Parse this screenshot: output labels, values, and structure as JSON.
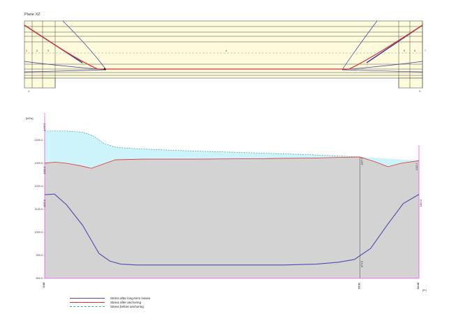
{
  "top_diagram": {
    "title": "Plane XZ",
    "span_labels_left": [
      "1",
      "2",
      "3"
    ],
    "span_label_center": "4",
    "span_labels_right": [
      "5",
      "6",
      "7"
    ],
    "support_left": "A",
    "support_right": "B",
    "colors": {
      "fill": "#fdfbdc",
      "tendon": "#dd3333",
      "guide": "#3b3b9a"
    }
  },
  "chart_data": {
    "type": "line",
    "ylabel": "[MPa]",
    "xlabel": "[m]",
    "ylim": [
      800,
      1500
    ],
    "xlim": [
      0,
      34.45
    ],
    "y_ticks": [
      "1400.0",
      "1300.0",
      "1200.0",
      "1100.0",
      "1000.0",
      "900.0",
      "800.0"
    ],
    "x_tick_labels": [
      "0.00",
      "29.01",
      "34.45"
    ],
    "annotations": [
      "1440.0",
      "1300.6",
      "1327.5",
      "1311.2",
      "1163.6",
      "1164.8",
      "874.8"
    ],
    "series": [
      {
        "name": "Stress after long-term losses",
        "color": "#4b4bb0",
        "x": [
          0,
          0.9,
          2.0,
          3.5,
          5.0,
          6.0,
          7.0,
          8.5,
          10,
          14,
          18,
          22,
          25,
          27,
          28.5,
          30,
          31.5,
          33,
          34.45
        ],
        "y": [
          1163.6,
          1166,
          1120,
          1030,
          908,
          875,
          862,
          858,
          858,
          858,
          858,
          858,
          862,
          870,
          882,
          930,
          1030,
          1125,
          1164.8
        ]
      },
      {
        "name": "Stress after anchoring",
        "color": "#dd3333",
        "x": [
          0,
          1.0,
          2.0,
          3.2,
          4.3,
          5.3,
          6.5,
          9,
          14,
          20,
          25,
          28.5,
          29.01,
          30.5,
          31.6,
          32.8,
          34.45
        ],
        "y": [
          1300.6,
          1305,
          1300,
          1290,
          1278,
          1295,
          1315,
          1318,
          1318,
          1320,
          1323,
          1327,
          1327.5,
          1305,
          1285,
          1300,
          1311.2
        ]
      },
      {
        "name": "Stress before anchoring",
        "color": "#49a098",
        "x": [
          0,
          2.0,
          3.5,
          4.5,
          5.5,
          6.5,
          8,
          12,
          18,
          24,
          29.01
        ],
        "y": [
          1440.0,
          1440,
          1435,
          1418,
          1385,
          1370,
          1364,
          1356,
          1347,
          1338,
          1327.5
        ]
      }
    ],
    "grid": false,
    "legend": "bottom-left"
  }
}
